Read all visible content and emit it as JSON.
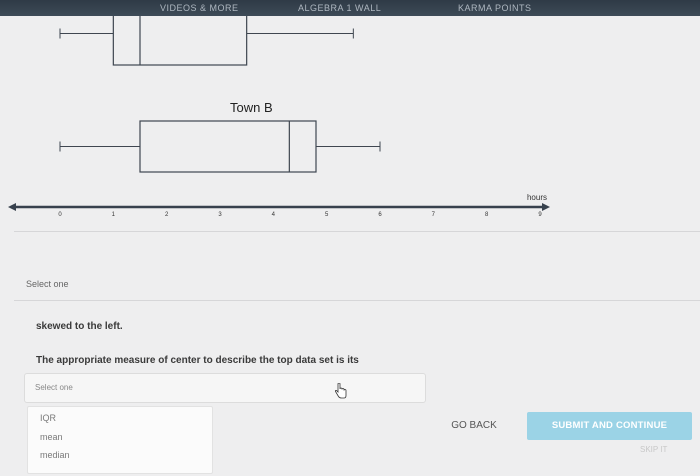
{
  "nav": {
    "items": [
      "VIDEOS & MORE",
      "ALGEBRA 1 WALL",
      "KARMA POINTS"
    ]
  },
  "chart_data": [
    {
      "type": "boxplot",
      "title": "",
      "boxes": [
        {
          "min": 0,
          "q1": 1,
          "median": 1.5,
          "q3": 3.5,
          "max": 5.5,
          "note": "top box plot, partially cut off at top of screen"
        },
        {
          "name": "Town B",
          "min": 0,
          "q1": 1.5,
          "median": 4.3,
          "q3": 4.8,
          "max": 6
        }
      ],
      "x_axis": {
        "label": "hours",
        "range": [
          0,
          9
        ],
        "ticks": [
          "0",
          "1",
          "2",
          "3",
          "4",
          "5",
          "6",
          "7",
          "8",
          "9"
        ]
      },
      "grid": false
    }
  ],
  "question1": {
    "select_placeholder": "Select one",
    "answer": "skewed to the left."
  },
  "question2": {
    "prompt": "The appropriate measure of center to describe the top data set is its",
    "select_placeholder": "Select one",
    "options": [
      "IQR",
      "mean",
      "median"
    ]
  },
  "buttons": {
    "go_back": "GO BACK",
    "submit": "SUBMIT AND CONTINUE",
    "skip": "SKIP IT"
  },
  "colors": {
    "boxplot": "#3f4650",
    "axis_line": "#37414d",
    "submit_bg": "#9bd3e6"
  }
}
